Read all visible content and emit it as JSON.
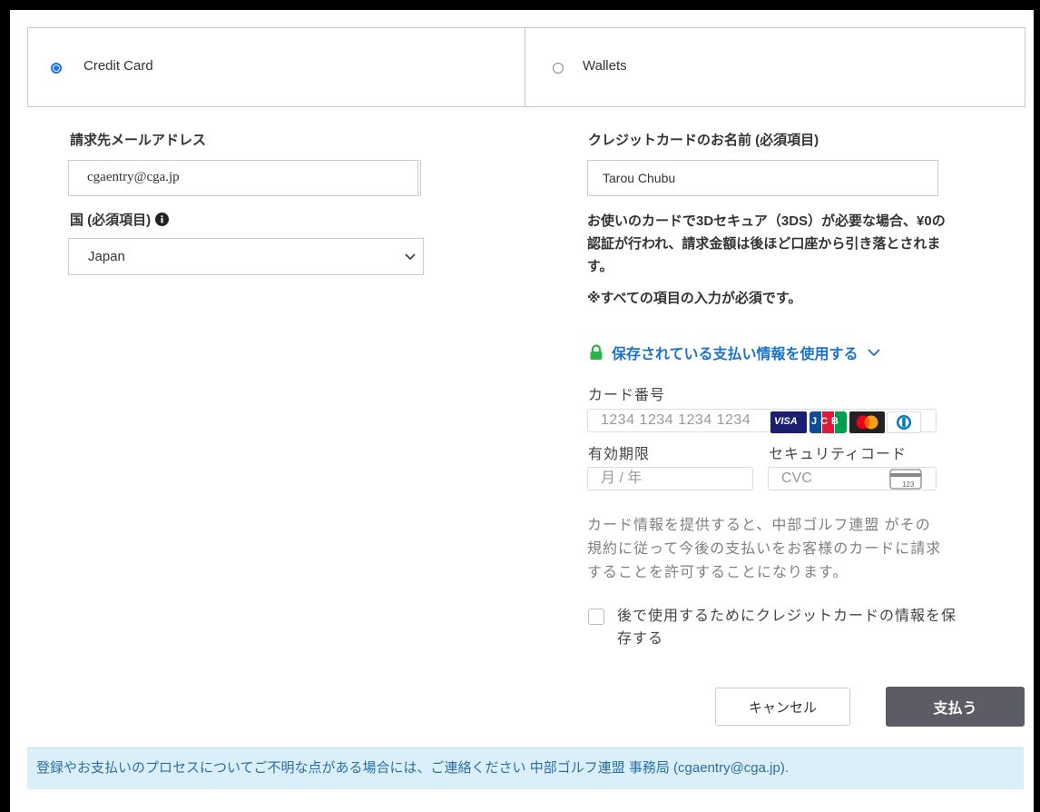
{
  "payment_tabs": [
    {
      "label": "Credit Card",
      "selected": true
    },
    {
      "label": "Wallets",
      "selected": false
    }
  ],
  "billing": {
    "email_label": "請求先メールアドレス",
    "email_value": "cgaentry@cga.jp",
    "country_label": "国 (必須項目)",
    "country_value": "Japan"
  },
  "card": {
    "name_label": "クレジットカードのお名前 (必須項目)",
    "name_value": "Tarou Chubu",
    "notice_3ds": "お使いのカードで3Dセキュア（3DS）が必要な場合、¥0の認証が行われ、請求金額は後ほど口座から引き落とされます。",
    "required_notice": "※すべての項目の入力が必須です。",
    "saved_payment_link": "保存されている支払い情報を使用する",
    "number_label": "カード番号",
    "number_placeholder": "1234 1234 1234 1234",
    "expiry_label": "有効期限",
    "expiry_placeholder": "月 / 年",
    "cvc_label": "セキュリティコード",
    "cvc_placeholder": "CVC",
    "cvc_icon_text": "123",
    "brands": [
      "VISA",
      "JCB",
      "Mastercard",
      "Diners Club"
    ],
    "brand_visa_text": "VISA",
    "brand_jcb_text": "JCB",
    "authorization_text": "カード情報を提供すると、中部ゴルフ連盟 がその規約に従って今後の支払いをお客様のカードに請求することを許可することになります。",
    "save_card_label": "後で使用するためにクレジットカードの情報を保存する"
  },
  "actions": {
    "cancel": "キャンセル",
    "pay": "支払う"
  },
  "footer": {
    "text": "登録やお支払いのプロセスについてご不明な点がある場合には、ご連絡ください 中部ゴルフ連盟 事務局 (cgaentry@cga.jp)."
  },
  "colors": {
    "accent": "#1a73e8",
    "link": "#1a73c8",
    "lock": "#2db34a",
    "pay_button": "#5c5c66",
    "footer_bg": "#dbeff8",
    "footer_text": "#2a6fa8"
  }
}
